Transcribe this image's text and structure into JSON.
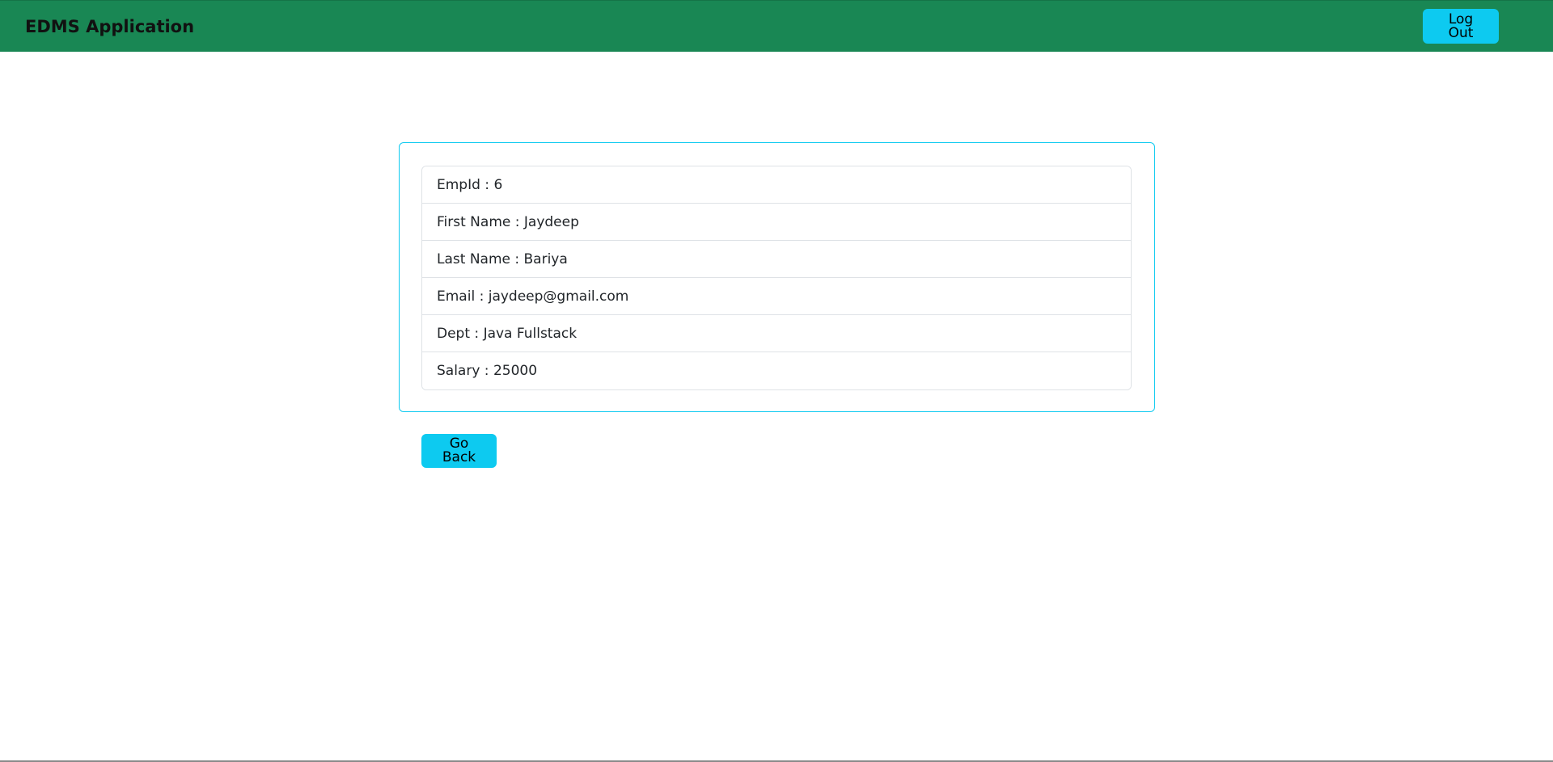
{
  "navbar": {
    "brand": "EDMS Application",
    "logout_label": "Log Out"
  },
  "employee": {
    "fields": [
      {
        "label": "EmpId",
        "value": "6"
      },
      {
        "label": "First Name",
        "value": "Jaydeep"
      },
      {
        "label": "Last Name",
        "value": "Bariya"
      },
      {
        "label": "Email",
        "value": "jaydeep@gmail.com"
      },
      {
        "label": "Dept",
        "value": "Java Fullstack"
      },
      {
        "label": "Salary",
        "value": "25000"
      }
    ],
    "separator": " : "
  },
  "actions": {
    "go_back_label": "Go Back"
  },
  "colors": {
    "navbar_bg": "#198754",
    "accent": "#0dcaf0",
    "border": "#dee2e6"
  }
}
